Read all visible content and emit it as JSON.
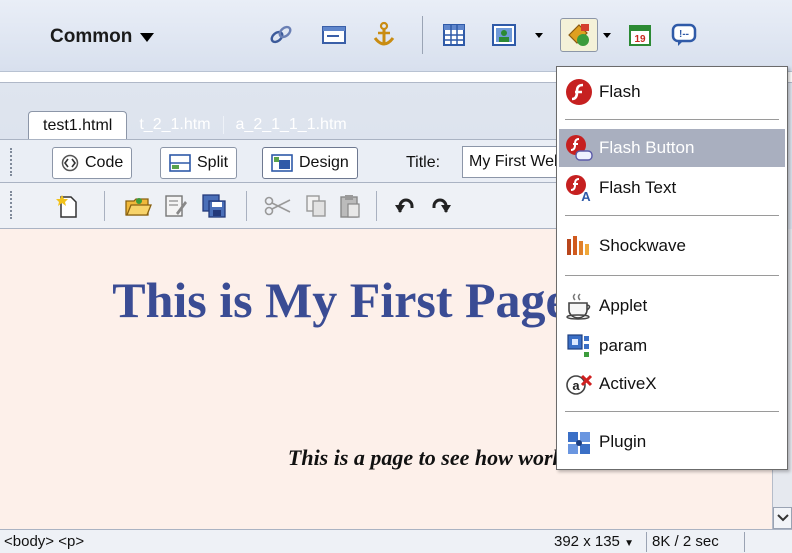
{
  "insert_bar": {
    "category": "Common",
    "tools": [
      "hyperlink-icon",
      "email-link-icon",
      "named-anchor-icon",
      "table-icon",
      "image-icon",
      "media-icon",
      "date-icon",
      "comment-icon"
    ]
  },
  "tabs": [
    "test1.html",
    "t_2_1.htm",
    "a_2_1_1_1.htm"
  ],
  "document_toolbar": {
    "code": "Code",
    "split": "Split",
    "design": "Design",
    "title_label": "Title:",
    "title_value": "My First Web Page"
  },
  "page": {
    "heading": "This is My First Page",
    "paragraph": "This is a page to see how works"
  },
  "status": {
    "tags": "<body> <p>",
    "window_size": "392 x 135",
    "download": "8K / 2 sec"
  },
  "media_menu": {
    "items": [
      {
        "label": "Flash",
        "icon": "flash-icon"
      },
      {
        "label": "Flash Button",
        "icon": "flash-button-icon",
        "highlighted": true
      },
      {
        "label": "Flash Text",
        "icon": "flash-text-icon"
      },
      {
        "label": "Shockwave",
        "icon": "shockwave-icon"
      },
      {
        "label": "Applet",
        "icon": "applet-icon"
      },
      {
        "label": "param",
        "icon": "param-icon"
      },
      {
        "label": "ActiveX",
        "icon": "activex-icon"
      },
      {
        "label": "Plugin",
        "icon": "plugin-icon"
      }
    ]
  },
  "colors": {
    "heading": "#3a4c94",
    "canvas": "#fdf0ea",
    "menu_highlight": "#a9afbf"
  }
}
